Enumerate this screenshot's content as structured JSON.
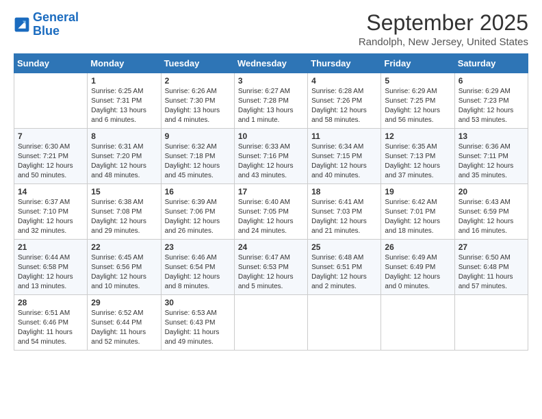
{
  "logo": {
    "line1": "General",
    "line2": "Blue"
  },
  "title": "September 2025",
  "subtitle": "Randolph, New Jersey, United States",
  "days_of_week": [
    "Sunday",
    "Monday",
    "Tuesday",
    "Wednesday",
    "Thursday",
    "Friday",
    "Saturday"
  ],
  "weeks": [
    [
      {
        "day": "",
        "sunrise": "",
        "sunset": "",
        "daylight": ""
      },
      {
        "day": "1",
        "sunrise": "Sunrise: 6:25 AM",
        "sunset": "Sunset: 7:31 PM",
        "daylight": "Daylight: 13 hours and 6 minutes."
      },
      {
        "day": "2",
        "sunrise": "Sunrise: 6:26 AM",
        "sunset": "Sunset: 7:30 PM",
        "daylight": "Daylight: 13 hours and 4 minutes."
      },
      {
        "day": "3",
        "sunrise": "Sunrise: 6:27 AM",
        "sunset": "Sunset: 7:28 PM",
        "daylight": "Daylight: 13 hours and 1 minute."
      },
      {
        "day": "4",
        "sunrise": "Sunrise: 6:28 AM",
        "sunset": "Sunset: 7:26 PM",
        "daylight": "Daylight: 12 hours and 58 minutes."
      },
      {
        "day": "5",
        "sunrise": "Sunrise: 6:29 AM",
        "sunset": "Sunset: 7:25 PM",
        "daylight": "Daylight: 12 hours and 56 minutes."
      },
      {
        "day": "6",
        "sunrise": "Sunrise: 6:29 AM",
        "sunset": "Sunset: 7:23 PM",
        "daylight": "Daylight: 12 hours and 53 minutes."
      }
    ],
    [
      {
        "day": "7",
        "sunrise": "Sunrise: 6:30 AM",
        "sunset": "Sunset: 7:21 PM",
        "daylight": "Daylight: 12 hours and 50 minutes."
      },
      {
        "day": "8",
        "sunrise": "Sunrise: 6:31 AM",
        "sunset": "Sunset: 7:20 PM",
        "daylight": "Daylight: 12 hours and 48 minutes."
      },
      {
        "day": "9",
        "sunrise": "Sunrise: 6:32 AM",
        "sunset": "Sunset: 7:18 PM",
        "daylight": "Daylight: 12 hours and 45 minutes."
      },
      {
        "day": "10",
        "sunrise": "Sunrise: 6:33 AM",
        "sunset": "Sunset: 7:16 PM",
        "daylight": "Daylight: 12 hours and 43 minutes."
      },
      {
        "day": "11",
        "sunrise": "Sunrise: 6:34 AM",
        "sunset": "Sunset: 7:15 PM",
        "daylight": "Daylight: 12 hours and 40 minutes."
      },
      {
        "day": "12",
        "sunrise": "Sunrise: 6:35 AM",
        "sunset": "Sunset: 7:13 PM",
        "daylight": "Daylight: 12 hours and 37 minutes."
      },
      {
        "day": "13",
        "sunrise": "Sunrise: 6:36 AM",
        "sunset": "Sunset: 7:11 PM",
        "daylight": "Daylight: 12 hours and 35 minutes."
      }
    ],
    [
      {
        "day": "14",
        "sunrise": "Sunrise: 6:37 AM",
        "sunset": "Sunset: 7:10 PM",
        "daylight": "Daylight: 12 hours and 32 minutes."
      },
      {
        "day": "15",
        "sunrise": "Sunrise: 6:38 AM",
        "sunset": "Sunset: 7:08 PM",
        "daylight": "Daylight: 12 hours and 29 minutes."
      },
      {
        "day": "16",
        "sunrise": "Sunrise: 6:39 AM",
        "sunset": "Sunset: 7:06 PM",
        "daylight": "Daylight: 12 hours and 26 minutes."
      },
      {
        "day": "17",
        "sunrise": "Sunrise: 6:40 AM",
        "sunset": "Sunset: 7:05 PM",
        "daylight": "Daylight: 12 hours and 24 minutes."
      },
      {
        "day": "18",
        "sunrise": "Sunrise: 6:41 AM",
        "sunset": "Sunset: 7:03 PM",
        "daylight": "Daylight: 12 hours and 21 minutes."
      },
      {
        "day": "19",
        "sunrise": "Sunrise: 6:42 AM",
        "sunset": "Sunset: 7:01 PM",
        "daylight": "Daylight: 12 hours and 18 minutes."
      },
      {
        "day": "20",
        "sunrise": "Sunrise: 6:43 AM",
        "sunset": "Sunset: 6:59 PM",
        "daylight": "Daylight: 12 hours and 16 minutes."
      }
    ],
    [
      {
        "day": "21",
        "sunrise": "Sunrise: 6:44 AM",
        "sunset": "Sunset: 6:58 PM",
        "daylight": "Daylight: 12 hours and 13 minutes."
      },
      {
        "day": "22",
        "sunrise": "Sunrise: 6:45 AM",
        "sunset": "Sunset: 6:56 PM",
        "daylight": "Daylight: 12 hours and 10 minutes."
      },
      {
        "day": "23",
        "sunrise": "Sunrise: 6:46 AM",
        "sunset": "Sunset: 6:54 PM",
        "daylight": "Daylight: 12 hours and 8 minutes."
      },
      {
        "day": "24",
        "sunrise": "Sunrise: 6:47 AM",
        "sunset": "Sunset: 6:53 PM",
        "daylight": "Daylight: 12 hours and 5 minutes."
      },
      {
        "day": "25",
        "sunrise": "Sunrise: 6:48 AM",
        "sunset": "Sunset: 6:51 PM",
        "daylight": "Daylight: 12 hours and 2 minutes."
      },
      {
        "day": "26",
        "sunrise": "Sunrise: 6:49 AM",
        "sunset": "Sunset: 6:49 PM",
        "daylight": "Daylight: 12 hours and 0 minutes."
      },
      {
        "day": "27",
        "sunrise": "Sunrise: 6:50 AM",
        "sunset": "Sunset: 6:48 PM",
        "daylight": "Daylight: 11 hours and 57 minutes."
      }
    ],
    [
      {
        "day": "28",
        "sunrise": "Sunrise: 6:51 AM",
        "sunset": "Sunset: 6:46 PM",
        "daylight": "Daylight: 11 hours and 54 minutes."
      },
      {
        "day": "29",
        "sunrise": "Sunrise: 6:52 AM",
        "sunset": "Sunset: 6:44 PM",
        "daylight": "Daylight: 11 hours and 52 minutes."
      },
      {
        "day": "30",
        "sunrise": "Sunrise: 6:53 AM",
        "sunset": "Sunset: 6:43 PM",
        "daylight": "Daylight: 11 hours and 49 minutes."
      },
      {
        "day": "",
        "sunrise": "",
        "sunset": "",
        "daylight": ""
      },
      {
        "day": "",
        "sunrise": "",
        "sunset": "",
        "daylight": ""
      },
      {
        "day": "",
        "sunrise": "",
        "sunset": "",
        "daylight": ""
      },
      {
        "day": "",
        "sunrise": "",
        "sunset": "",
        "daylight": ""
      }
    ]
  ]
}
